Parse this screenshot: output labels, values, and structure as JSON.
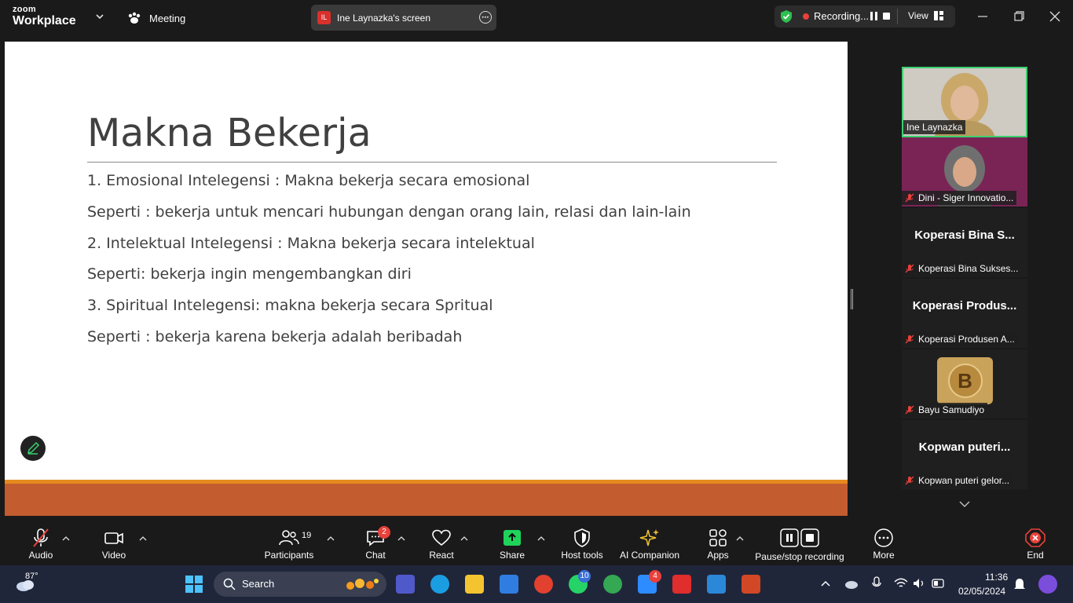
{
  "app": {
    "brand_small": "zoom",
    "brand_large": "Workplace",
    "meeting_label": "Meeting"
  },
  "share": {
    "initials": "IL",
    "label": "Ine Laynazka's screen"
  },
  "recording": {
    "label": "Recording...",
    "view_label": "View"
  },
  "slide": {
    "title": "Makna Bekerja",
    "lines": [
      "1. Emosional Intelegensi : Makna bekerja secara emosional",
      "Seperti : bekerja untuk mencari hubungan dengan orang lain, relasi dan lain-lain",
      "2. Intelektual Intelegensi : Makna bekerja secara intelektual",
      "Seperti: bekerja ingin mengembangkan diri",
      "3. Spiritual Intelegensi: makna bekerja secara Spritual",
      "Seperti : bekerja karena bekerja adalah beribadah"
    ]
  },
  "participants": [
    {
      "name": "Ine Laynazka",
      "big": ""
    },
    {
      "name": "Dini - Siger Innovatio...",
      "big": ""
    },
    {
      "name": "Koperasi Bina Sukses...",
      "big": "Koperasi Bina S..."
    },
    {
      "name": "Koperasi Produsen A...",
      "big": "Koperasi  Produs..."
    },
    {
      "name": "Bayu Samudiyo",
      "big": ""
    },
    {
      "name": "Kopwan puteri gelor...",
      "big": "Kopwan  puteri..."
    }
  ],
  "avatar_letter": "B",
  "toolbar": {
    "audio": "Audio",
    "video": "Video",
    "participants": "Participants",
    "participants_count": "19",
    "chat": "Chat",
    "chat_badge": "2",
    "react": "React",
    "share": "Share",
    "host_tools": "Host tools",
    "ai_companion": "AI Companion",
    "apps": "Apps",
    "pause_stop": "Pause/stop recording",
    "more": "More",
    "end": "End"
  },
  "taskbar": {
    "weather": "87°",
    "search": "Search",
    "zoom_badge": "4",
    "whatsapp_badge": "10",
    "time": "11:36",
    "date": "02/05/2024"
  }
}
